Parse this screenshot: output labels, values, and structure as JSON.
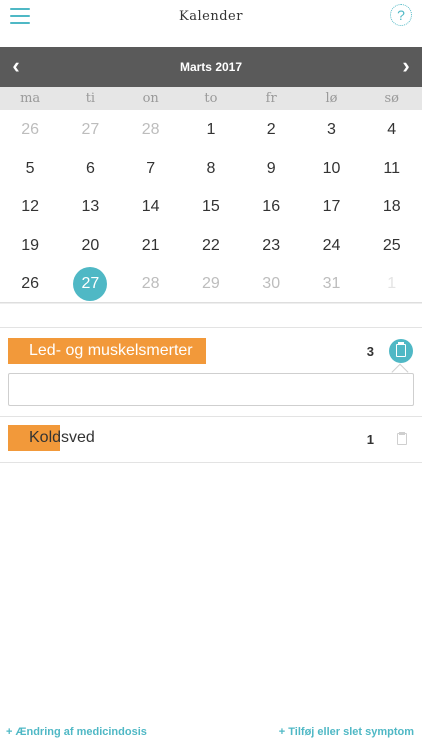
{
  "header": {
    "title": "Kalender",
    "help_symbol": "?"
  },
  "calendar": {
    "month_label": "Marts 2017",
    "prev_symbol": "‹",
    "next_symbol": "›",
    "weekdays": [
      "ma",
      "ti",
      "on",
      "to",
      "fr",
      "lø",
      "sø"
    ],
    "weeks": [
      [
        {
          "d": "26",
          "s": "muted"
        },
        {
          "d": "27",
          "s": "muted"
        },
        {
          "d": "28",
          "s": "muted"
        },
        {
          "d": "1",
          "s": ""
        },
        {
          "d": "2",
          "s": ""
        },
        {
          "d": "3",
          "s": ""
        },
        {
          "d": "4",
          "s": ""
        }
      ],
      [
        {
          "d": "5",
          "s": ""
        },
        {
          "d": "6",
          "s": ""
        },
        {
          "d": "7",
          "s": ""
        },
        {
          "d": "8",
          "s": ""
        },
        {
          "d": "9",
          "s": ""
        },
        {
          "d": "10",
          "s": ""
        },
        {
          "d": "11",
          "s": ""
        }
      ],
      [
        {
          "d": "12",
          "s": ""
        },
        {
          "d": "13",
          "s": ""
        },
        {
          "d": "14",
          "s": ""
        },
        {
          "d": "15",
          "s": ""
        },
        {
          "d": "16",
          "s": ""
        },
        {
          "d": "17",
          "s": ""
        },
        {
          "d": "18",
          "s": ""
        }
      ],
      [
        {
          "d": "19",
          "s": ""
        },
        {
          "d": "20",
          "s": ""
        },
        {
          "d": "21",
          "s": ""
        },
        {
          "d": "22",
          "s": ""
        },
        {
          "d": "23",
          "s": ""
        },
        {
          "d": "24",
          "s": ""
        },
        {
          "d": "25",
          "s": ""
        }
      ],
      [
        {
          "d": "26",
          "s": ""
        },
        {
          "d": "27",
          "s": "selected"
        },
        {
          "d": "28",
          "s": "muted"
        },
        {
          "d": "29",
          "s": "muted"
        },
        {
          "d": "30",
          "s": "muted"
        },
        {
          "d": "31",
          "s": "muted"
        },
        {
          "d": "1",
          "s": "faint"
        }
      ]
    ]
  },
  "symptoms": [
    {
      "label": "Led- og muskelsmerter",
      "count": "3",
      "tag_fill": 1.0,
      "active": true
    },
    {
      "label": "Koldsved",
      "count": "1",
      "tag_fill": 0.4,
      "active": false
    }
  ],
  "note": {
    "value": "",
    "placeholder": ""
  },
  "footer": {
    "left_link": "+ Ændring af medicindosis",
    "right_link": "+ Tilføj eller slet symptom"
  },
  "colors": {
    "accent": "#4fb8c5",
    "tag": "#f2993a",
    "month_bar": "#5a5a5a"
  },
  "icons": [
    "menu-icon",
    "help-icon",
    "chevron-left-icon",
    "chevron-right-icon",
    "clipboard-icon"
  ]
}
